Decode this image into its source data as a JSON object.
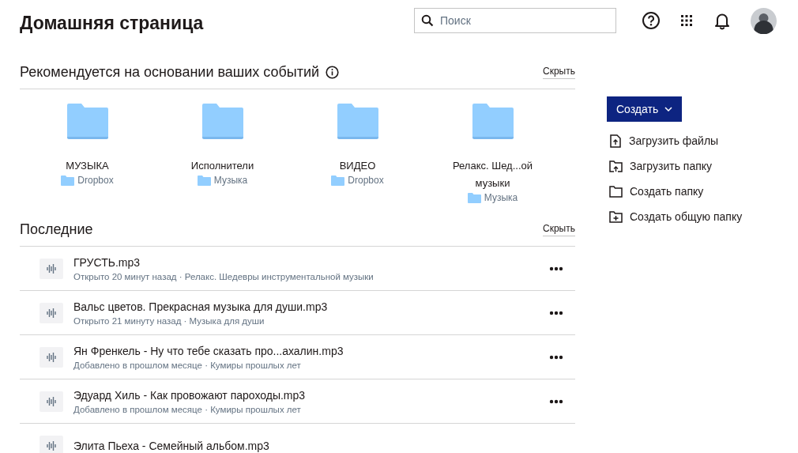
{
  "page_title": "Домашняя страница",
  "search": {
    "placeholder": "Поиск"
  },
  "suggested": {
    "title": "Рекомендуется на основании ваших событий",
    "hide": "Скрыть",
    "folders": [
      {
        "name": "МУЗЫКА",
        "location": "Dropbox"
      },
      {
        "name": "Исполнители",
        "location": "Музыка"
      },
      {
        "name": "ВИДЕО",
        "location": "Dropbox"
      },
      {
        "name": "Релакс. Шед...ой музыки",
        "location": "Музыка"
      }
    ]
  },
  "recent": {
    "title": "Последние",
    "hide": "Скрыть",
    "files": [
      {
        "name": "ГРУСТЬ.mp3",
        "detail": "Открыто 20 минут назад · Релакс. Шедевры инструментальной музыки"
      },
      {
        "name": "Вальс цветов. Прекрасная музыка для души.mp3",
        "detail": "Открыто 21 минуту назад · Музыка для души"
      },
      {
        "name": "Ян Френкель - Ну что тебе сказать про...ахалин.mp3",
        "detail": "Добавлено в прошлом месяце · Кумиры прошлых лет"
      },
      {
        "name": "Эдуард Хиль - Как провожают пароходы.mp3",
        "detail": "Добавлено в прошлом месяце · Кумиры прошлых лет"
      },
      {
        "name": "Элита Пьеха - Семейный альбом.mp3"
      }
    ]
  },
  "create_button": "Создать",
  "actions": [
    {
      "kind": "upload-file",
      "label": "Загрузить файлы"
    },
    {
      "kind": "upload-folder",
      "label": "Загрузить папку"
    },
    {
      "kind": "new-folder",
      "label": "Создать папку"
    },
    {
      "kind": "shared-folder",
      "label": "Создать общую папку"
    }
  ]
}
